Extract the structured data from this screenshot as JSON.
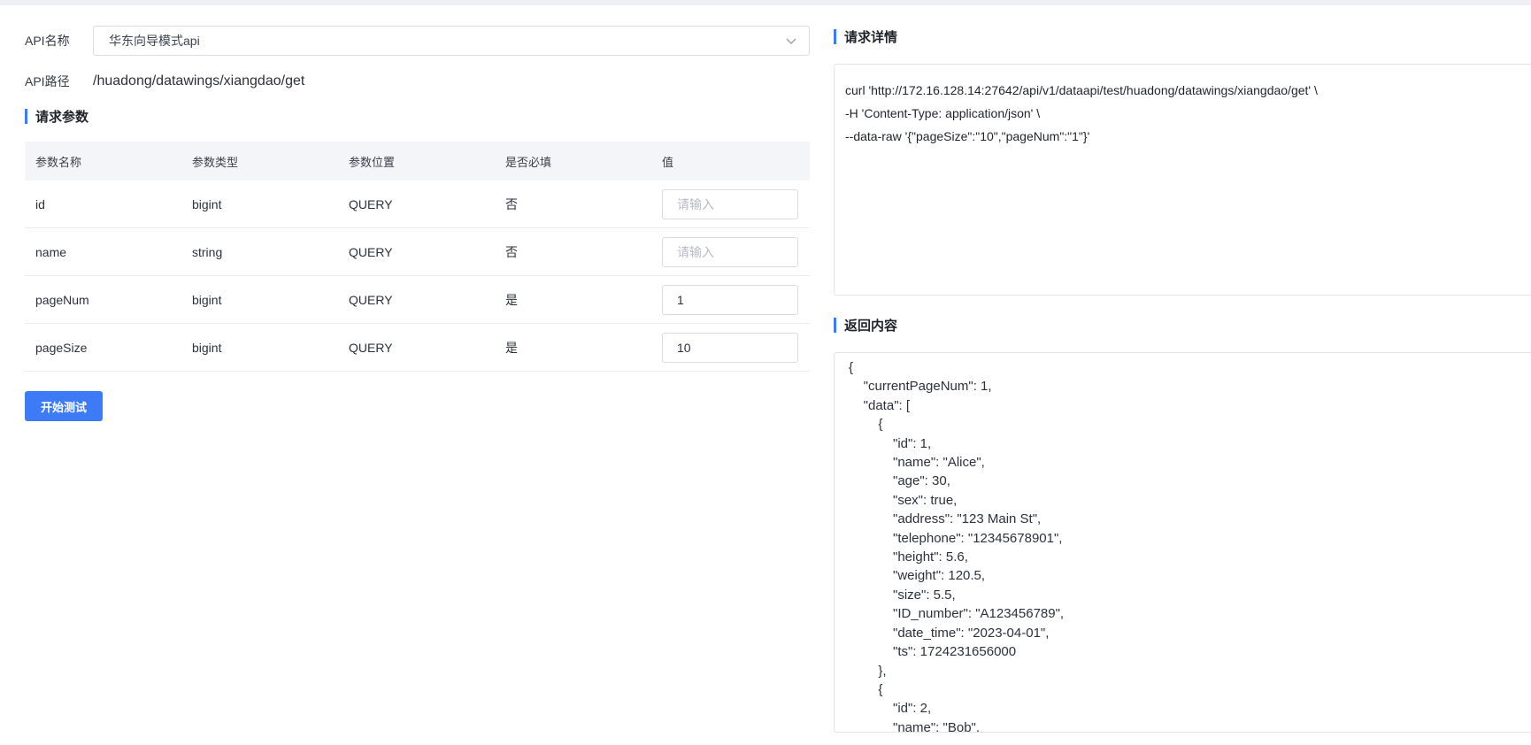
{
  "form": {
    "api_name_label": "API名称",
    "api_name_value": "华东向导模式api",
    "api_path_label": "API路径",
    "api_path_value": "/huadong/datawings/xiangdao/get"
  },
  "params": {
    "title": "请求参数",
    "headers": [
      "参数名称",
      "参数类型",
      "参数位置",
      "是否必填",
      "值"
    ],
    "rows": [
      {
        "name": "id",
        "type": "bigint",
        "position": "QUERY",
        "required": "否",
        "value": "",
        "placeholder": "请输入"
      },
      {
        "name": "name",
        "type": "string",
        "position": "QUERY",
        "required": "否",
        "value": "",
        "placeholder": "请输入"
      },
      {
        "name": "pageNum",
        "type": "bigint",
        "position": "QUERY",
        "required": "是",
        "value": "1",
        "placeholder": "请输入"
      },
      {
        "name": "pageSize",
        "type": "bigint",
        "position": "QUERY",
        "required": "是",
        "value": "10",
        "placeholder": "请输入"
      }
    ],
    "start_button": "开始测试"
  },
  "request": {
    "title": "请求详情",
    "lines": [
      "curl 'http://172.16.128.14:27642/api/v1/dataapi/test/huadong/datawings/xiangdao/get' \\",
      "-H 'Content-Type: application/json' \\",
      "--data-raw '{\"pageSize\":\"10\",\"pageNum\":\"1\"}'"
    ]
  },
  "response": {
    "title": "返回内容",
    "lines": [
      "{",
      "    \"currentPageNum\": 1,",
      "    \"data\": [",
      "        {",
      "            \"id\": 1,",
      "            \"name\": \"Alice\",",
      "            \"age\": 30,",
      "            \"sex\": true,",
      "            \"address\": \"123 Main St\",",
      "            \"telephone\": \"12345678901\",",
      "            \"height\": 5.6,",
      "            \"weight\": 120.5,",
      "            \"size\": 5.5,",
      "            \"ID_number\": \"A123456789\",",
      "            \"date_time\": \"2023-04-01\",",
      "            \"ts\": 1724231656000",
      "        },",
      "        {",
      "            \"id\": 2,",
      "            \"name\": \"Bob\","
    ]
  },
  "icons": {
    "select_arrow": "chevron-down-icon"
  },
  "colors": {
    "accent": "#3d7bf6",
    "header_bg": "#f4f5f8",
    "border": "#d9dce3"
  }
}
